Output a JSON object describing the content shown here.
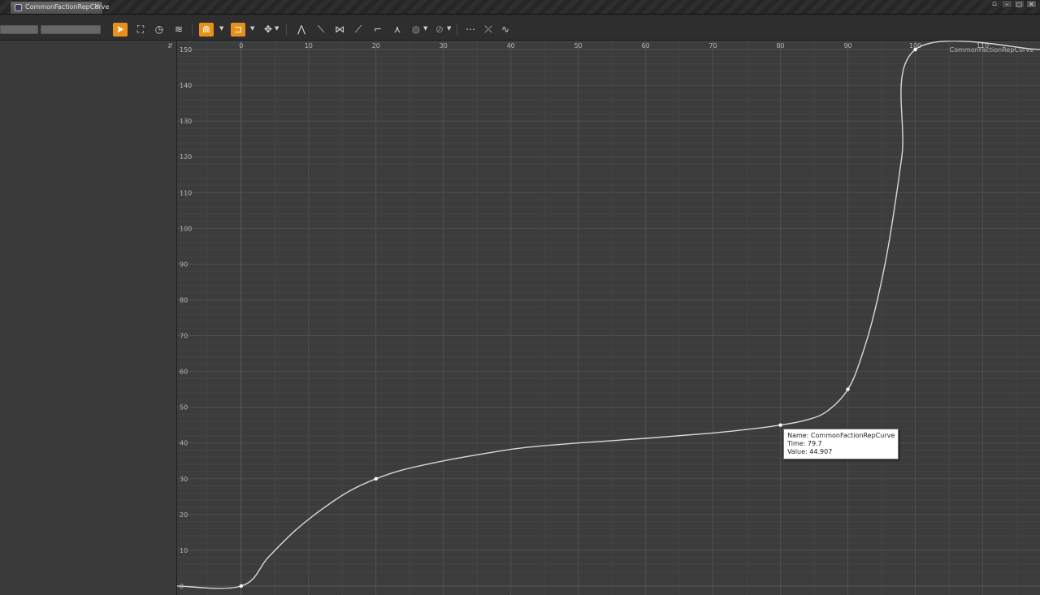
{
  "window": {
    "tab_title": "CommonFactionRepCurve",
    "tab_close": "×",
    "buttons": {
      "help": "⌂",
      "minimize": "–",
      "maximize": "▢",
      "close": "✕"
    }
  },
  "toolbar": {
    "tools": [
      {
        "name": "select-tool",
        "icon": "pointer-icon",
        "glyph": "➤",
        "active": true
      },
      {
        "name": "frame-tool",
        "icon": "frame-icon",
        "glyph": "⛶",
        "active": false
      },
      {
        "name": "time-tool",
        "icon": "clock-icon",
        "glyph": "◷",
        "active": false
      },
      {
        "name": "curves-tool",
        "icon": "curves-icon",
        "glyph": "≋",
        "active": false
      }
    ],
    "snap_value": {
      "icon": "magnet-icon",
      "glyph": "⋒",
      "active": true
    },
    "snap_time": {
      "icon": "snap-time-icon",
      "glyph": "⊐",
      "active": true
    },
    "transform": {
      "icon": "move-icon",
      "glyph": "✥"
    },
    "tangent_tools": [
      {
        "name": "auto-tangent",
        "glyph": "⋀"
      },
      {
        "name": "user-tangent",
        "glyph": "⟍"
      },
      {
        "name": "break-tangent",
        "glyph": "⋈"
      },
      {
        "name": "linear-tangent",
        "glyph": "⟋"
      },
      {
        "name": "constant-tangent",
        "glyph": "⌐"
      },
      {
        "name": "flatten-tangent",
        "glyph": "⋏"
      },
      {
        "name": "pre-infinity",
        "glyph": "◍"
      },
      {
        "name": "post-infinity",
        "glyph": "⊘"
      }
    ],
    "key_tools": [
      {
        "name": "add-key",
        "glyph": "⋯"
      },
      {
        "name": "flatten-keys",
        "glyph": "⤫"
      },
      {
        "name": "filter",
        "glyph": "∿"
      }
    ]
  },
  "graph": {
    "corner_label": "⇵",
    "curve_label": "CommonFactionRepCurve",
    "tooltip": {
      "name_line": "Name: CommonFactionRepCurve",
      "time_line": "Time: 79.7",
      "value_line": "Value: 44.907"
    }
  },
  "chart_data": {
    "type": "line",
    "title": "",
    "xlabel": "",
    "ylabel": "",
    "x_ticks": [
      0,
      10,
      20,
      30,
      40,
      50,
      60,
      70,
      80,
      90,
      100,
      110
    ],
    "y_ticks": [
      0,
      10,
      20,
      30,
      40,
      50,
      60,
      70,
      80,
      90,
      100,
      110,
      120,
      130,
      140,
      150
    ],
    "xlim": [
      -9.5,
      118.5
    ],
    "ylim": [
      -2.5,
      152.5
    ],
    "grid": true,
    "series": [
      {
        "name": "CommonFactionRepCurve",
        "color": "#d8d8d8",
        "keys": [
          {
            "x": 0,
            "y": 0
          },
          {
            "x": 20,
            "y": 30
          },
          {
            "x": 80,
            "y": 45
          },
          {
            "x": 90,
            "y": 55
          },
          {
            "x": 100,
            "y": 150
          }
        ],
        "points": [
          {
            "x": -9.5,
            "y": 0
          },
          {
            "x": 0,
            "y": 0
          },
          {
            "x": 4,
            "y": 8
          },
          {
            "x": 8,
            "y": 15.5
          },
          {
            "x": 12,
            "y": 21.5
          },
          {
            "x": 16,
            "y": 26.5
          },
          {
            "x": 20,
            "y": 30
          },
          {
            "x": 24,
            "y": 32.5
          },
          {
            "x": 30,
            "y": 35
          },
          {
            "x": 36,
            "y": 37
          },
          {
            "x": 42,
            "y": 38.7
          },
          {
            "x": 50,
            "y": 40
          },
          {
            "x": 60,
            "y": 41.3
          },
          {
            "x": 70,
            "y": 42.8
          },
          {
            "x": 76,
            "y": 44
          },
          {
            "x": 80,
            "y": 45
          },
          {
            "x": 84,
            "y": 46.5
          },
          {
            "x": 87,
            "y": 49
          },
          {
            "x": 90,
            "y": 55
          },
          {
            "x": 92,
            "y": 64
          },
          {
            "x": 94,
            "y": 77
          },
          {
            "x": 96,
            "y": 95
          },
          {
            "x": 98,
            "y": 120
          },
          {
            "x": 100,
            "y": 150
          },
          {
            "x": 118.5,
            "y": 150
          }
        ]
      }
    ],
    "hover": {
      "x": 79.7,
      "y": 44.907
    }
  }
}
